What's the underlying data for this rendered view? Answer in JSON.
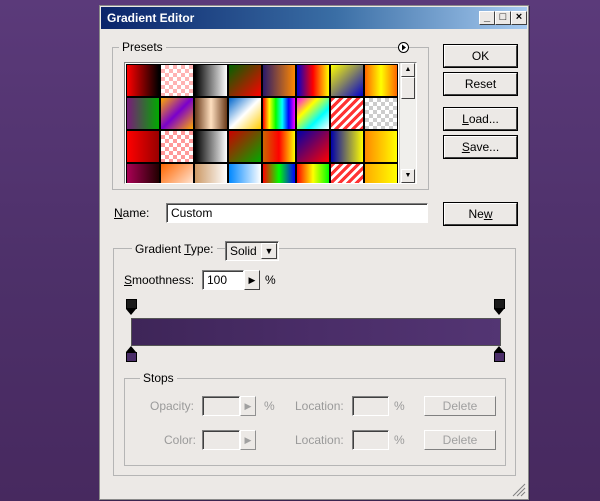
{
  "window": {
    "title": "Gradient Editor",
    "controls": [
      "_",
      "□",
      "×"
    ]
  },
  "presets": {
    "label": "Presets",
    "menu_icon": "arrow-right-circle-icon",
    "swatches": [
      "linear-gradient(90deg,#ff0000,#000000)",
      "repeating-conic-gradient(#ffb3b3 0 25%,#ffffff 0 50%) 0 0/8px 8px",
      "linear-gradient(90deg,#000000,#ffffff)",
      "linear-gradient(135deg,#006400,#ff0000)",
      "linear-gradient(90deg,#2a1a6a,#ff8800)",
      "linear-gradient(90deg,#0000cc,#ff0000,#ffff00)",
      "linear-gradient(135deg,#ffff00,#0000cc)",
      "linear-gradient(90deg,#ff6600,#ffff00,#ff6600)",
      "linear-gradient(90deg,#7a1a7a,#00aa00)",
      "linear-gradient(135deg,#ffaa00,#7a00cc,#ffaa00)",
      "linear-gradient(90deg,#6a3a1a,#ffe0c0,#6a3a1a)",
      "linear-gradient(135deg,#0066cc,#ffffff,#ffcc00)",
      "linear-gradient(90deg,#ff0000,#ffff00,#00ff00,#00ffff,#0000ff,#ff00ff)",
      "linear-gradient(135deg,#ff00ff,#ffff00,#00ffff,#ffffff)",
      "repeating-linear-gradient(135deg,#ff3333 0 3px,#ffffff 3px 6px)",
      "repeating-conic-gradient(#cccccc 0 25%,#ffffff 0 50%) 0 0/8px 8px",
      "linear-gradient(90deg,#ff0000,#990000)",
      "repeating-conic-gradient(#ff9999 0 25%,#ffffff 0 50%) 0 0/8px 8px",
      "linear-gradient(90deg,#000000,#ffffff)",
      "linear-gradient(135deg,#cc0000,#00aa00)",
      "linear-gradient(90deg,#cc6600,#ff0000,#ffff00)",
      "linear-gradient(135deg,#0000aa,#ff0000)",
      "linear-gradient(90deg,#0000aa,#ffff00)",
      "linear-gradient(90deg,#ff8800,#ffff00)",
      "linear-gradient(90deg,#aa0055,#220000)",
      "linear-gradient(135deg,#ff6600,#ffffff)",
      "linear-gradient(90deg,#cc9966,#ffffff)",
      "linear-gradient(90deg,#0088ff,#ffffff)",
      "linear-gradient(90deg,#ff0000,#00ff00,#0000ff)",
      "linear-gradient(90deg,#ff0000,#ffff00,#00ff00)",
      "repeating-linear-gradient(135deg,#ff3333 0 3px,#ffffff 3px 6px)",
      "linear-gradient(90deg,#ffaa00,#ffff00)"
    ]
  },
  "name": {
    "label_prefix": "",
    "label_u": "N",
    "label_rest": "ame:",
    "value": "Custom"
  },
  "gradient_type": {
    "label_prefix": "Gradient ",
    "label_u": "T",
    "label_rest": "ype:",
    "value": "Solid",
    "dropdown_icon": "chevron-down-icon"
  },
  "smoothness": {
    "label_u": "S",
    "label_rest": "moothness:",
    "value": "100",
    "unit": "%",
    "arrow_icon": "chevron-right-icon"
  },
  "gradient": {
    "colors": [
      "#3e2558",
      "#4a2d68",
      "#533573"
    ],
    "opacity_stop_color": "#1a1a1a",
    "color_stop_color": "#4a2d68"
  },
  "stops": {
    "label": "Stops",
    "opacity_label": "Opacity:",
    "opacity_unit": "%",
    "location_label": "Location:",
    "location_unit": "%",
    "color_label": "Color:",
    "delete_label": "Delete"
  },
  "buttons": {
    "ok": "OK",
    "reset": "Reset",
    "load_u": "L",
    "load_rest": "oad...",
    "save_u": "S",
    "save_rest": "ave...",
    "new_prefix": "Ne",
    "new_u": "w"
  },
  "resize_icon": "resize-grip-icon"
}
